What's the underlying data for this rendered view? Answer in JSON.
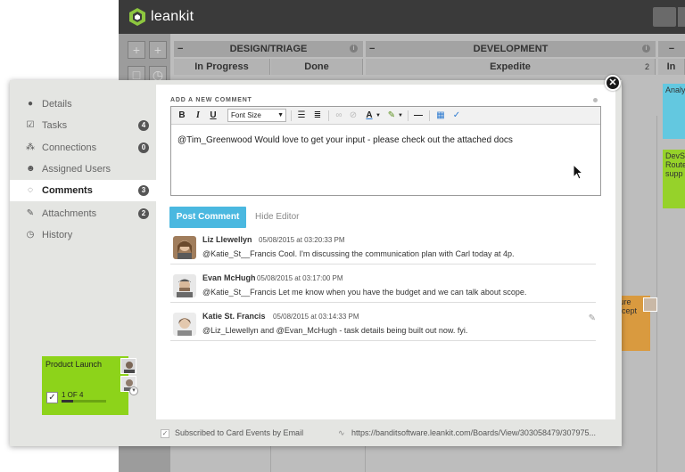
{
  "app": {
    "logo_text": "leankit"
  },
  "board": {
    "lanes": [
      {
        "title": "DESIGN/TRIAGE",
        "minus": "−",
        "info": "i"
      },
      {
        "title": "DEVELOPMENT",
        "minus": "−",
        "info": "i"
      }
    ],
    "sublanes": [
      {
        "title": "In Progress"
      },
      {
        "title": "Done"
      },
      {
        "title": "Expedite",
        "count": "2"
      },
      {
        "title": "In"
      }
    ],
    "side_cards": [
      {
        "text": "Analy"
      },
      {
        "text": "DevS Route supp"
      },
      {
        "text": "ture ncept"
      }
    ]
  },
  "sidebar": {
    "items": [
      {
        "label": "Details",
        "icon": "info-icon",
        "badge": ""
      },
      {
        "label": "Tasks",
        "icon": "checkbox-icon",
        "badge": "4"
      },
      {
        "label": "Connections",
        "icon": "hierarchy-icon",
        "badge": "0"
      },
      {
        "label": "Assigned Users",
        "icon": "users-icon",
        "badge": ""
      },
      {
        "label": "Comments",
        "icon": "comments-icon",
        "badge": "3",
        "active": true
      },
      {
        "label": "Attachments",
        "icon": "paperclip-icon",
        "badge": "2"
      },
      {
        "label": "History",
        "icon": "clock-icon",
        "badge": ""
      }
    ]
  },
  "editor": {
    "section_label": "ADD A NEW COMMENT",
    "font_select": "Font Size",
    "text": "@Tim_Greenwood Would love to get your input - please check out the attached docs",
    "toolbar": {
      "bold": "B",
      "italic": "I",
      "underline": "U"
    }
  },
  "actions": {
    "post_label": "Post Comment",
    "hide_label": "Hide Editor"
  },
  "comments": [
    {
      "author": "Liz Llewellyn",
      "date": "05/08/2015 at 03:20:33 PM",
      "text": "@Katie_St__Francis Cool. I'm discussing the communication plan with Carl today at 4p."
    },
    {
      "author": "Evan McHugh",
      "date": "05/08/2015 at 03:17:00 PM",
      "text": "@Katie_St__Francis Let me know when you have the budget and we can talk about scope."
    },
    {
      "author": "Katie St. Francis",
      "date": "05/08/2015 at 03:14:33 PM",
      "text": "@Liz_Llewellyn and @Evan_McHugh - task details being built out now. fyi."
    }
  ],
  "footer": {
    "subscribed_label": "Subscribed to Card Events by Email",
    "url": "https://banditsoftware.leankit.com/Boards/View/303058479/307975..."
  },
  "card": {
    "title": "Product Launch",
    "progress_label": "1 OF 4",
    "progress_fraction": 0.25,
    "color": "#8dd31a"
  },
  "colors": {
    "accent": "#4ab8e0",
    "topbar": "#3a3a3a"
  }
}
